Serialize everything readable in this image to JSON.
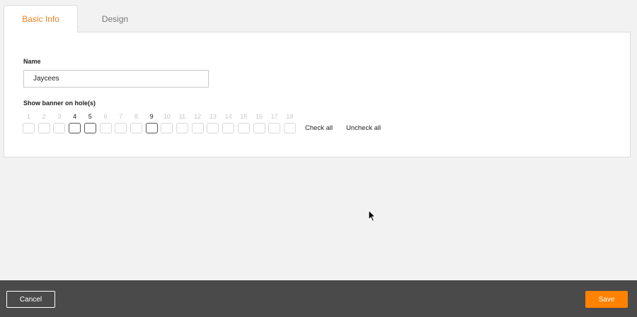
{
  "tabs": [
    {
      "label": "Basic Info",
      "active": true
    },
    {
      "label": "Design",
      "active": false
    }
  ],
  "form": {
    "name_label": "Name",
    "name_value": "Jaycees",
    "banner_label": "Show banner on hole(s)",
    "holes": [
      {
        "number": "1",
        "checked": false
      },
      {
        "number": "2",
        "checked": false
      },
      {
        "number": "3",
        "checked": false
      },
      {
        "number": "4",
        "checked": true
      },
      {
        "number": "5",
        "checked": true
      },
      {
        "number": "6",
        "checked": false
      },
      {
        "number": "7",
        "checked": false
      },
      {
        "number": "8",
        "checked": false
      },
      {
        "number": "9",
        "checked": true
      },
      {
        "number": "10",
        "checked": false
      },
      {
        "number": "11",
        "checked": false
      },
      {
        "number": "12",
        "checked": false
      },
      {
        "number": "13",
        "checked": false
      },
      {
        "number": "14",
        "checked": false
      },
      {
        "number": "15",
        "checked": false
      },
      {
        "number": "16",
        "checked": false
      },
      {
        "number": "17",
        "checked": false
      },
      {
        "number": "18",
        "checked": false
      }
    ],
    "check_all": "Check all",
    "uncheck_all": "Uncheck all"
  },
  "footer": {
    "cancel_label": "Cancel",
    "save_label": "Save"
  },
  "colors": {
    "accent": "#ff8200",
    "active_tab_text": "#f58220",
    "footer_bg": "#4a4a4a",
    "page_bg": "#f2f2f2"
  },
  "icons": {
    "cursor": "mouse-pointer-icon"
  }
}
